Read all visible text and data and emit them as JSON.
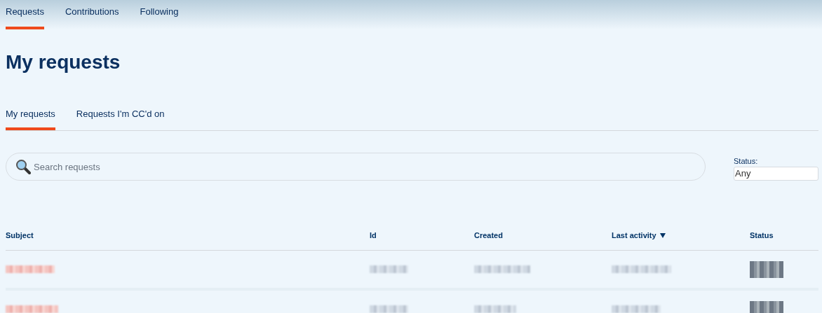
{
  "nav_tabs": [
    {
      "label": "Requests",
      "selected": true
    },
    {
      "label": "Contributions",
      "selected": false
    },
    {
      "label": "Following",
      "selected": false
    }
  ],
  "page_title": "My requests",
  "sub_tabs": [
    {
      "label": "My requests",
      "selected": true
    },
    {
      "label": "Requests I'm CC'd on",
      "selected": false
    }
  ],
  "search": {
    "placeholder": "Search requests"
  },
  "status_filter": {
    "label": "Status:",
    "value": "Any"
  },
  "table": {
    "columns": [
      {
        "label": "Subject",
        "sorted": false
      },
      {
        "label": "Id",
        "sorted": false
      },
      {
        "label": "Created",
        "sorted": false
      },
      {
        "label": "Last activity",
        "sorted": true
      },
      {
        "label": "Status",
        "sorted": false
      }
    ],
    "rows": [
      {
        "kind": "redacted"
      },
      {
        "kind": "redacted"
      }
    ]
  }
}
